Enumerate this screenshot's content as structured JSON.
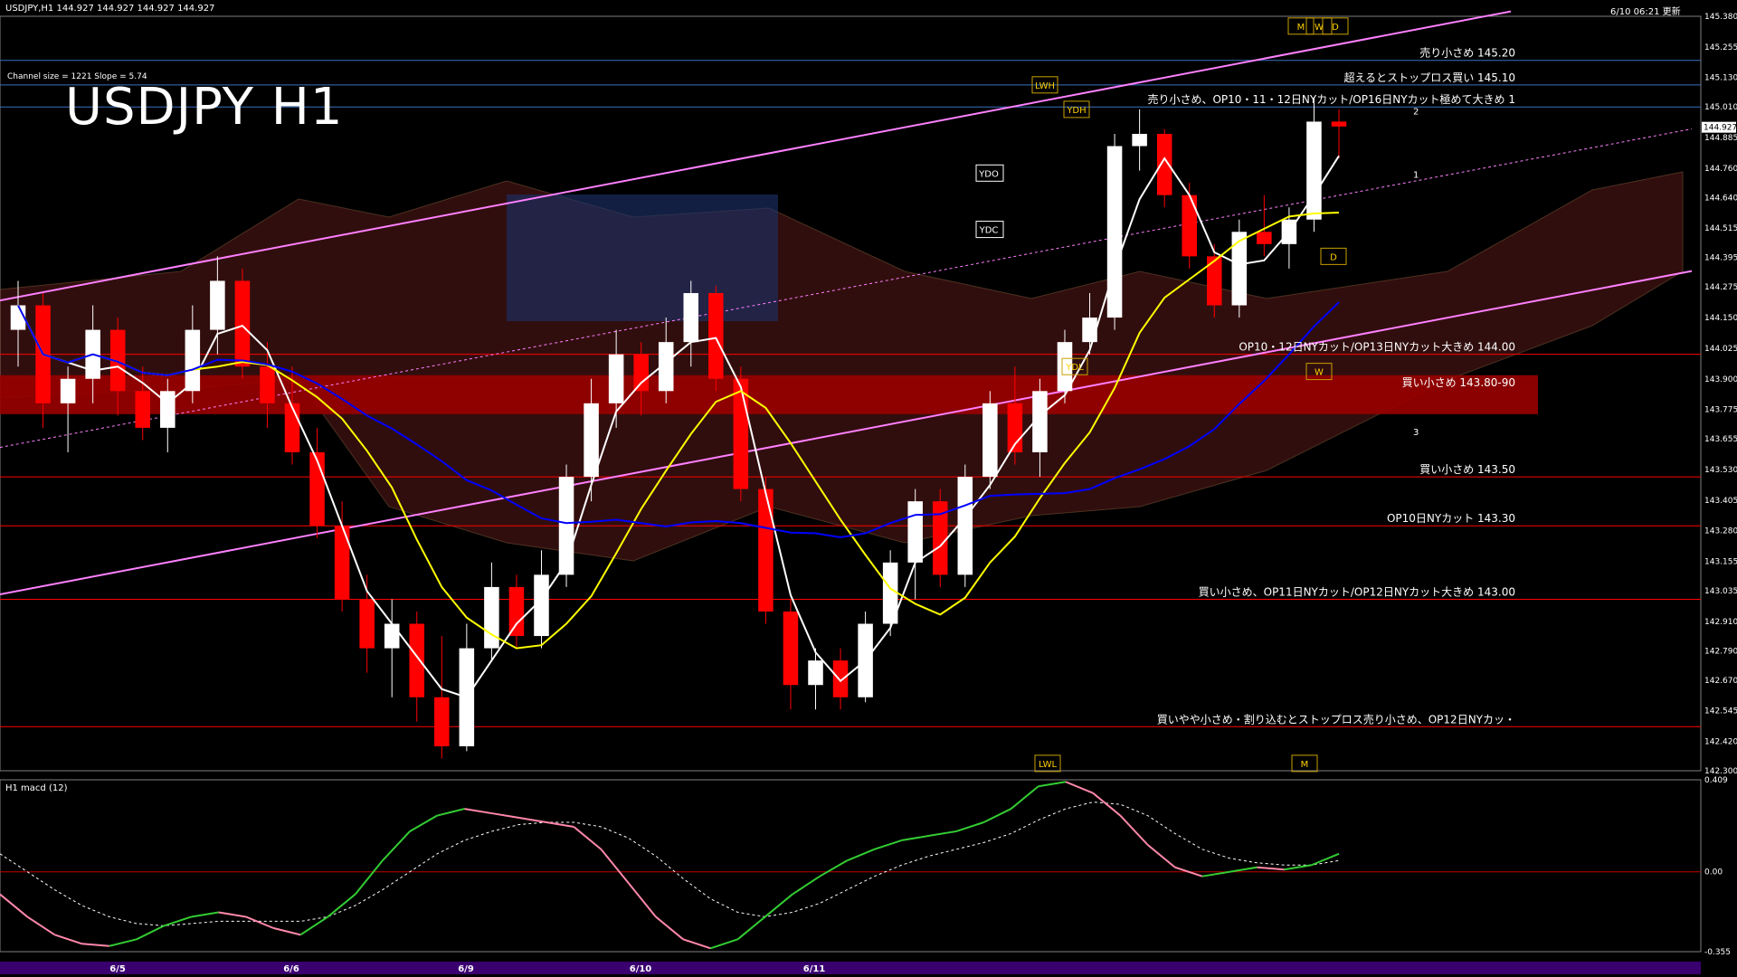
{
  "header": {
    "symbol_info": "USDJPY,H1  144.927 144.927 144.927 144.927",
    "timestamp": "6/10 06:21 更新",
    "channel_info": "Channel size = 1221 Slope = 5.74"
  },
  "title": "USDJPY H1",
  "colors": {
    "background": "#000000",
    "bull_candle": "#ffffff",
    "bear_candle": "#ff0000",
    "channel": "#ff80ff",
    "ma_white": "#ffffff",
    "ma_yellow": "#ffff00",
    "ma_blue": "#0000ff",
    "lagging_green": "#00c000",
    "bollinger_red": "#c00000",
    "support_red": "#ff0000",
    "resistance_blue": "#3a6fc0",
    "macd_green": "#33cc33",
    "macd_pink": "#ff88aa"
  },
  "chart_data": {
    "type": "candlestick",
    "title": "USDJPY H1",
    "yaxis": {
      "min": 142.3,
      "max": 145.38,
      "ticks": [
        "145.380",
        "145.255",
        "145.130",
        "145.010",
        "144.885",
        "144.760",
        "144.640",
        "144.515",
        "144.395",
        "144.275",
        "144.150",
        "144.025",
        "143.900",
        "143.775",
        "143.655",
        "143.530",
        "143.405",
        "143.280",
        "143.155",
        "143.035",
        "142.910",
        "142.790",
        "142.670",
        "142.545",
        "142.420",
        "142.300"
      ]
    },
    "current_price": "144.927",
    "dates": [
      "6/5",
      "6/6",
      "6/9",
      "6/10",
      "6/11"
    ],
    "levels": [
      {
        "price": 145.2,
        "color": "#3a6fc0",
        "label": "売り小さめ 145.20"
      },
      {
        "price": 145.1,
        "color": "#3a6fc0",
        "label": "超えるとストップロス買い 145.10"
      },
      {
        "price": 145.01,
        "color": "#3a6fc0",
        "label": "売り小さめ、OP10・11・12日NYカット/OP16日NYカット極めて大きめ 1"
      },
      {
        "price": 144.0,
        "color": "#ff0000",
        "label": "OP10・12日NYカット/OP13日NYカット大きめ 144.00"
      },
      {
        "price": 143.5,
        "color": "#ff0000",
        "label": "買い小さめ 143.50"
      },
      {
        "price": 143.3,
        "color": "#ff0000",
        "label": "OP10日NYカット 143.30"
      },
      {
        "price": 143.0,
        "color": "#ff0000",
        "label": "買い小さめ、OP11日NYカット/OP12日NYカット大きめ 143.00"
      },
      {
        "price": 142.48,
        "color": "#ff0000",
        "label": "買いやや小さめ・割り込むとストップロス売り小さめ、OP12日NYカッ・"
      }
    ],
    "zone": {
      "from": 143.8,
      "to": 143.9,
      "label": "買い小さめ 143.80-90"
    },
    "markers": [
      "LWH",
      "YDH",
      "YDO",
      "YDC",
      "YDL",
      "LWL",
      "M",
      "W",
      "D",
      "D",
      "W",
      "M"
    ],
    "projection_labels": [
      "1",
      "2",
      "3"
    ],
    "candles": [
      {
        "o": 144.1,
        "h": 144.3,
        "l": 143.95,
        "c": 144.2
      },
      {
        "o": 144.2,
        "h": 144.25,
        "l": 143.7,
        "c": 143.8
      },
      {
        "o": 143.8,
        "h": 143.95,
        "l": 143.6,
        "c": 143.9
      },
      {
        "o": 143.9,
        "h": 144.2,
        "l": 143.8,
        "c": 144.1
      },
      {
        "o": 144.1,
        "h": 144.15,
        "l": 143.75,
        "c": 143.85
      },
      {
        "o": 143.85,
        "h": 143.95,
        "l": 143.65,
        "c": 143.7
      },
      {
        "o": 143.7,
        "h": 143.9,
        "l": 143.6,
        "c": 143.85
      },
      {
        "o": 143.85,
        "h": 144.2,
        "l": 143.8,
        "c": 144.1
      },
      {
        "o": 144.1,
        "h": 144.4,
        "l": 144.0,
        "c": 144.3
      },
      {
        "o": 144.3,
        "h": 144.35,
        "l": 143.9,
        "c": 143.95
      },
      {
        "o": 143.95,
        "h": 144.05,
        "l": 143.7,
        "c": 143.8
      },
      {
        "o": 143.8,
        "h": 143.95,
        "l": 143.55,
        "c": 143.6
      },
      {
        "o": 143.6,
        "h": 143.7,
        "l": 143.25,
        "c": 143.3
      },
      {
        "o": 143.3,
        "h": 143.4,
        "l": 142.95,
        "c": 143.0
      },
      {
        "o": 143.0,
        "h": 143.1,
        "l": 142.7,
        "c": 142.8
      },
      {
        "o": 142.8,
        "h": 143.0,
        "l": 142.6,
        "c": 142.9
      },
      {
        "o": 142.9,
        "h": 142.95,
        "l": 142.5,
        "c": 142.6
      },
      {
        "o": 142.6,
        "h": 142.85,
        "l": 142.35,
        "c": 142.4
      },
      {
        "o": 142.4,
        "h": 142.9,
        "l": 142.38,
        "c": 142.8
      },
      {
        "o": 142.8,
        "h": 143.15,
        "l": 142.75,
        "c": 143.05
      },
      {
        "o": 143.05,
        "h": 143.1,
        "l": 142.8,
        "c": 142.85
      },
      {
        "o": 142.85,
        "h": 143.2,
        "l": 142.8,
        "c": 143.1
      },
      {
        "o": 143.1,
        "h": 143.55,
        "l": 143.05,
        "c": 143.5
      },
      {
        "o": 143.5,
        "h": 143.9,
        "l": 143.4,
        "c": 143.8
      },
      {
        "o": 143.8,
        "h": 144.1,
        "l": 143.7,
        "c": 144.0
      },
      {
        "o": 144.0,
        "h": 144.05,
        "l": 143.75,
        "c": 143.85
      },
      {
        "o": 143.85,
        "h": 144.15,
        "l": 143.8,
        "c": 144.05
      },
      {
        "o": 144.05,
        "h": 144.3,
        "l": 143.95,
        "c": 144.25
      },
      {
        "o": 144.25,
        "h": 144.28,
        "l": 143.85,
        "c": 143.9
      },
      {
        "o": 143.9,
        "h": 143.95,
        "l": 143.4,
        "c": 143.45
      },
      {
        "o": 143.45,
        "h": 143.5,
        "l": 142.9,
        "c": 142.95
      },
      {
        "o": 142.95,
        "h": 143.0,
        "l": 142.55,
        "c": 142.65
      },
      {
        "o": 142.65,
        "h": 142.8,
        "l": 142.55,
        "c": 142.75
      },
      {
        "o": 142.75,
        "h": 142.8,
        "l": 142.55,
        "c": 142.6
      },
      {
        "o": 142.6,
        "h": 142.95,
        "l": 142.58,
        "c": 142.9
      },
      {
        "o": 142.9,
        "h": 143.2,
        "l": 142.85,
        "c": 143.15
      },
      {
        "o": 143.15,
        "h": 143.45,
        "l": 143.0,
        "c": 143.4
      },
      {
        "o": 143.4,
        "h": 143.45,
        "l": 143.05,
        "c": 143.1
      },
      {
        "o": 143.1,
        "h": 143.55,
        "l": 143.05,
        "c": 143.5
      },
      {
        "o": 143.5,
        "h": 143.85,
        "l": 143.45,
        "c": 143.8
      },
      {
        "o": 143.8,
        "h": 143.95,
        "l": 143.55,
        "c": 143.6
      },
      {
        "o": 143.6,
        "h": 143.9,
        "l": 143.5,
        "c": 143.85
      },
      {
        "o": 143.85,
        "h": 144.1,
        "l": 143.8,
        "c": 144.05
      },
      {
        "o": 144.05,
        "h": 144.25,
        "l": 144.0,
        "c": 144.15
      },
      {
        "o": 144.15,
        "h": 144.9,
        "l": 144.1,
        "c": 144.85
      },
      {
        "o": 144.85,
        "h": 145.0,
        "l": 144.75,
        "c": 144.9
      },
      {
        "o": 144.9,
        "h": 144.92,
        "l": 144.6,
        "c": 144.65
      },
      {
        "o": 144.65,
        "h": 144.7,
        "l": 144.35,
        "c": 144.4
      },
      {
        "o": 144.4,
        "h": 144.45,
        "l": 144.15,
        "c": 144.2
      },
      {
        "o": 144.2,
        "h": 144.55,
        "l": 144.15,
        "c": 144.5
      },
      {
        "o": 144.5,
        "h": 144.65,
        "l": 144.4,
        "c": 144.45
      },
      {
        "o": 144.45,
        "h": 144.6,
        "l": 144.35,
        "c": 144.55
      },
      {
        "o": 144.55,
        "h": 145.05,
        "l": 144.5,
        "c": 144.95
      },
      {
        "o": 144.95,
        "h": 145.0,
        "l": 144.8,
        "c": 144.93
      }
    ]
  },
  "macd": {
    "label": "H1  macd (12)",
    "ticks": [
      "0.409",
      "0.00",
      "-0.355"
    ],
    "main": [
      -0.1,
      -0.2,
      -0.28,
      -0.32,
      -0.33,
      -0.3,
      -0.24,
      -0.2,
      -0.18,
      -0.2,
      -0.25,
      -0.28,
      -0.2,
      -0.1,
      0.05,
      0.18,
      0.25,
      0.28,
      0.26,
      0.24,
      0.22,
      0.2,
      0.1,
      -0.05,
      -0.2,
      -0.3,
      -0.34,
      -0.3,
      -0.2,
      -0.1,
      -0.02,
      0.05,
      0.1,
      0.14,
      0.16,
      0.18,
      0.22,
      0.28,
      0.38,
      0.4,
      0.35,
      0.25,
      0.12,
      0.02,
      -0.02,
      0.0,
      0.02,
      0.01,
      0.03,
      0.08
    ],
    "signal": [
      0.08,
      0.0,
      -0.08,
      -0.15,
      -0.2,
      -0.23,
      -0.24,
      -0.23,
      -0.22,
      -0.22,
      -0.22,
      -0.22,
      -0.2,
      -0.15,
      -0.08,
      0.0,
      0.08,
      0.14,
      0.18,
      0.21,
      0.22,
      0.22,
      0.2,
      0.15,
      0.07,
      -0.03,
      -0.12,
      -0.18,
      -0.2,
      -0.18,
      -0.14,
      -0.08,
      -0.02,
      0.03,
      0.07,
      0.1,
      0.13,
      0.17,
      0.23,
      0.28,
      0.31,
      0.3,
      0.25,
      0.17,
      0.1,
      0.06,
      0.04,
      0.03,
      0.03,
      0.05
    ]
  }
}
